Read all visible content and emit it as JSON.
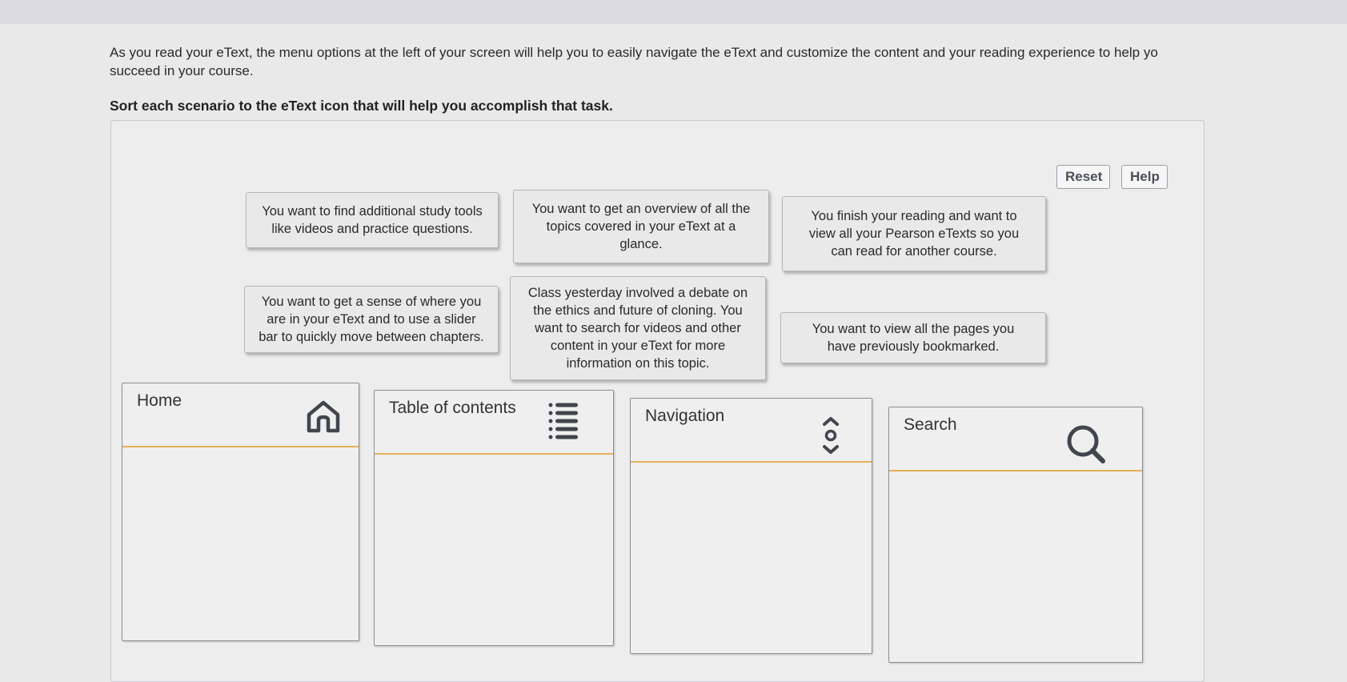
{
  "intro": {
    "line1": "As you read your eText, the menu options at the left of your screen will help you to easily navigate the eText and customize the content and your reading experience to help yo",
    "line2": "succeed in your course."
  },
  "instruction": "Sort each scenario to the eText icon that will help you accomplish that task.",
  "toolbar": {
    "reset_label": "Reset",
    "help_label": "Help"
  },
  "scenarios": [
    {
      "lines": [
        "You want to find additional study tools",
        "like videos and practice questions."
      ]
    },
    {
      "lines": [
        "You want to get an overview of all the",
        "topics covered in your eText at a",
        "glance."
      ]
    },
    {
      "lines": [
        "You finish your reading and want to",
        "view all your Pearson eTexts so you",
        "can read for another course."
      ]
    },
    {
      "lines": [
        "You want to get a sense of where you",
        "are in your eText and to use a slider",
        "bar to quickly move between chapters."
      ]
    },
    {
      "lines": [
        "Class yesterday involved a debate on",
        "the ethics and future of cloning. You",
        "want to search for videos and other",
        "content in your eText for more",
        "information on this topic."
      ]
    },
    {
      "lines": [
        "You want to view all the pages you",
        "have previously bookmarked."
      ]
    }
  ],
  "bins": [
    {
      "title": "Home",
      "icon": "home-icon"
    },
    {
      "title": "Table of contents",
      "icon": "list-icon"
    },
    {
      "title": "Navigation",
      "icon": "navigation-icon"
    },
    {
      "title": "Search",
      "icon": "search-icon"
    }
  ],
  "colors": {
    "divider_accent": "#e6b05a",
    "button_text": "#4a4f57"
  }
}
